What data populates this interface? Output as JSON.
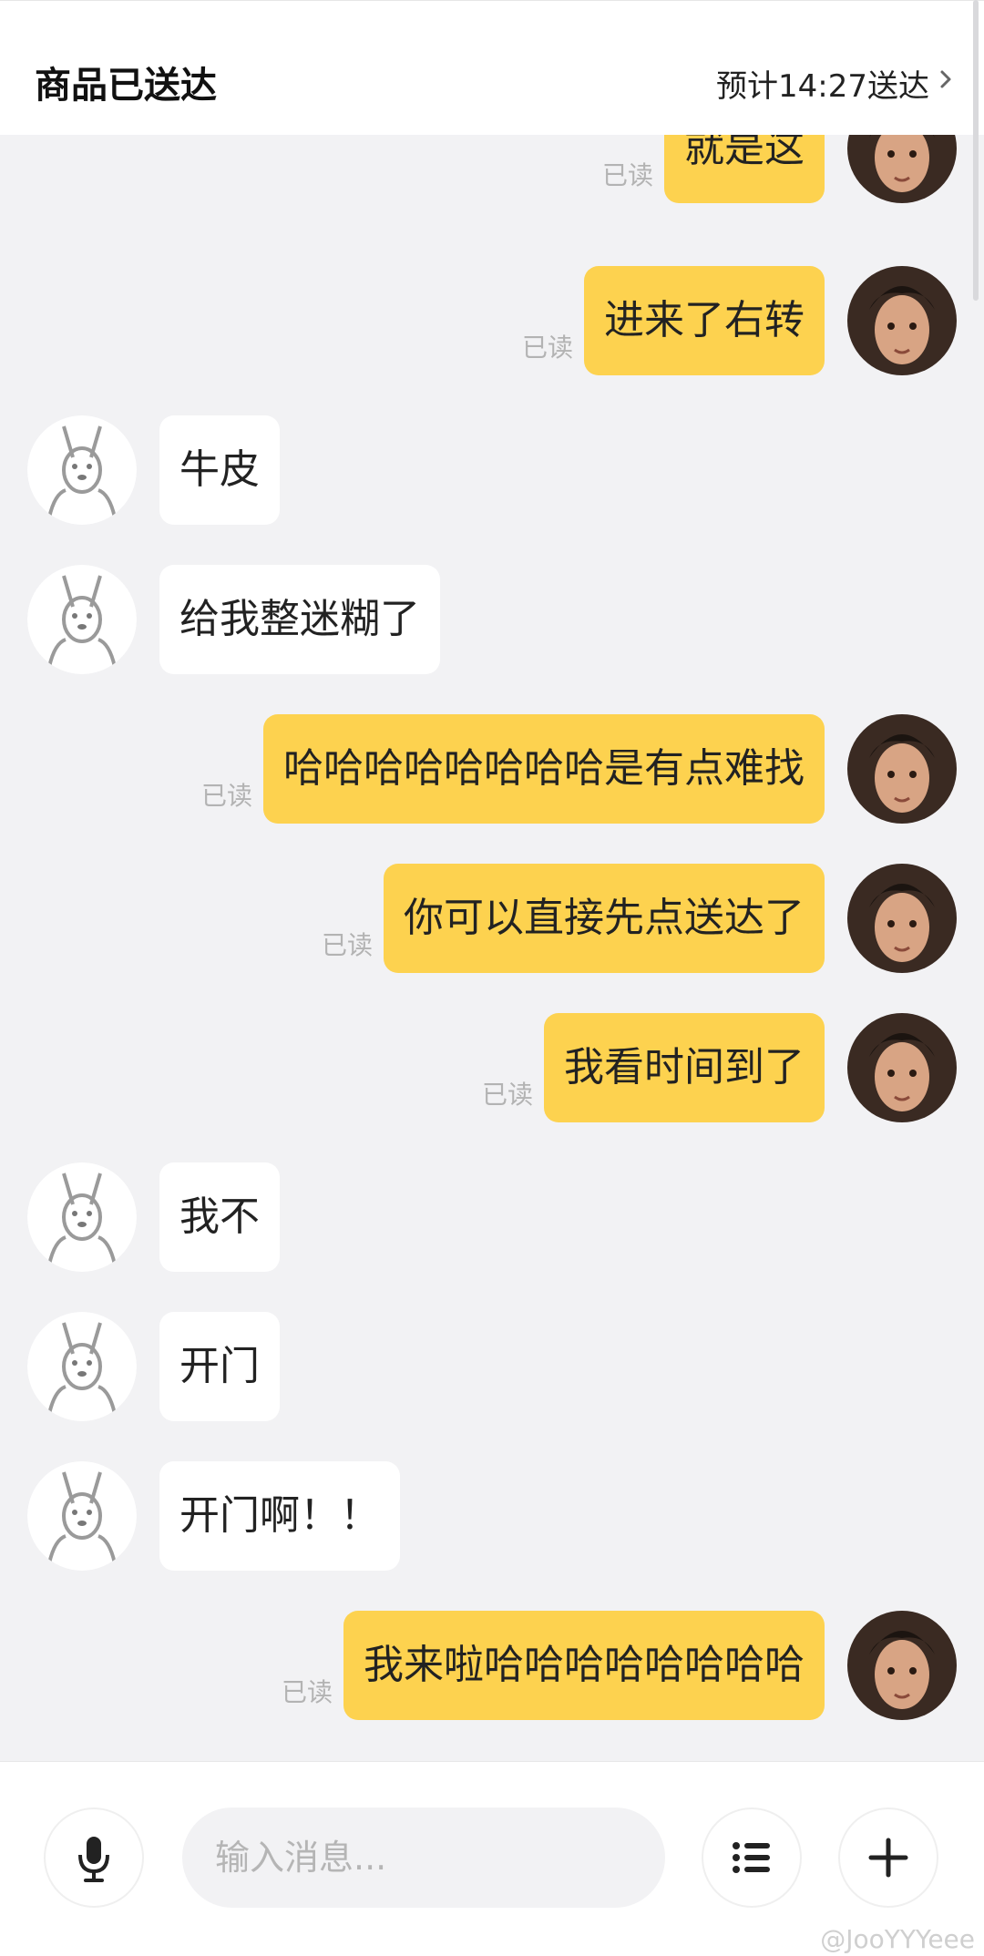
{
  "header": {
    "title": "商品已送达",
    "eta": "预计14:27送达"
  },
  "messages": [
    {
      "side": "me",
      "text": "就是这",
      "read": "已读"
    },
    {
      "side": "me",
      "text": "进来了右转",
      "read": "已读"
    },
    {
      "side": "them",
      "text": "牛皮"
    },
    {
      "side": "them",
      "text": "给我整迷糊了"
    },
    {
      "side": "me",
      "text": "哈哈哈哈哈哈哈哈是有点难找",
      "read": "已读"
    },
    {
      "side": "me",
      "text": "你可以直接先点送达了",
      "read": "已读"
    },
    {
      "side": "me",
      "text": "我看时间到了",
      "read": "已读"
    },
    {
      "side": "them",
      "text": "我不"
    },
    {
      "side": "them",
      "text": "开门"
    },
    {
      "side": "them",
      "text": "开门啊！！"
    },
    {
      "side": "me",
      "text": "我来啦哈哈哈哈哈哈哈哈",
      "read": "已读"
    }
  ],
  "input": {
    "placeholder": "输入消息..."
  },
  "icons": {
    "voice": "microphone-icon",
    "menu": "list-icon",
    "add": "plus-icon",
    "back": "chevron-right-icon"
  },
  "watermark": "@JooYYYeee",
  "colors": {
    "my_bubble": "#fdd24f",
    "their_bubble": "#ffffff",
    "background": "#f2f2f4",
    "read_text": "#b3b3b3"
  }
}
